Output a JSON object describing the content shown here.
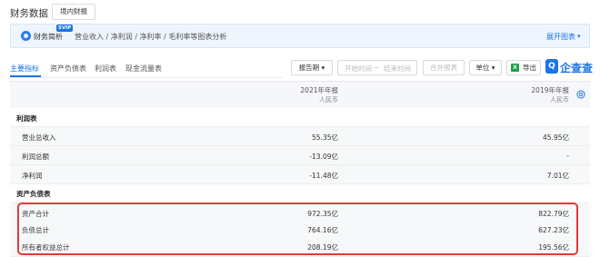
{
  "header": {
    "title": "财务数据",
    "scope_button": "境内财报"
  },
  "banner": {
    "label": "财务简析",
    "badge": "SVIP",
    "description": "营业收入 / 净利润 / 净利率 / 毛利率等图表分析",
    "expand_link": "展开图表",
    "expand_caret": "▾"
  },
  "tabs": [
    {
      "label": "主要指标",
      "active": true
    },
    {
      "label": "资产负债表",
      "active": false
    },
    {
      "label": "利润表",
      "active": false
    },
    {
      "label": "现金流量表",
      "active": false
    }
  ],
  "toolbar": {
    "period_select": "报告期 ▾",
    "start_placeholder": "开始时间",
    "range_separator": "~",
    "end_placeholder": "结束时间",
    "merge_button": "合并报表",
    "unit_select": "单位 ▾",
    "export_button": "导出",
    "export_icon": "X",
    "brand_mark": "Q",
    "brand_name": "企查查"
  },
  "table": {
    "columns": [
      {
        "period": "2021年年报",
        "currency": "人民币"
      },
      {
        "period": "2019年年报",
        "currency": "人民币"
      }
    ],
    "rows": [
      {
        "type": "section",
        "label": "利润表",
        "values": [
          "",
          ""
        ]
      },
      {
        "type": "data",
        "label": "营业总收入",
        "values": [
          "55.35亿",
          "45.95亿"
        ]
      },
      {
        "type": "data",
        "label": "利润总额",
        "values": [
          "-13.09亿",
          "-"
        ]
      },
      {
        "type": "data",
        "label": "净利润",
        "values": [
          "-11.48亿",
          "7.01亿"
        ]
      },
      {
        "type": "section",
        "label": "资产负债表",
        "values": [
          "",
          ""
        ]
      },
      {
        "type": "data",
        "label": "资产合计",
        "values": [
          "972.35亿",
          "822.79亿"
        ]
      },
      {
        "type": "data",
        "label": "负债总计",
        "values": [
          "764.16亿",
          "627.23亿"
        ]
      },
      {
        "type": "data",
        "label": "所有者权益总计",
        "values": [
          "208.19亿",
          "195.56亿"
        ]
      }
    ]
  },
  "colors": {
    "accent": "#1a74e8",
    "highlight": "#e53935",
    "excel_green": "#1e9e4a"
  },
  "icons": [
    "analysis-icon",
    "excel-icon",
    "settings-icon",
    "chevron-down-icon",
    "brand-logo"
  ]
}
